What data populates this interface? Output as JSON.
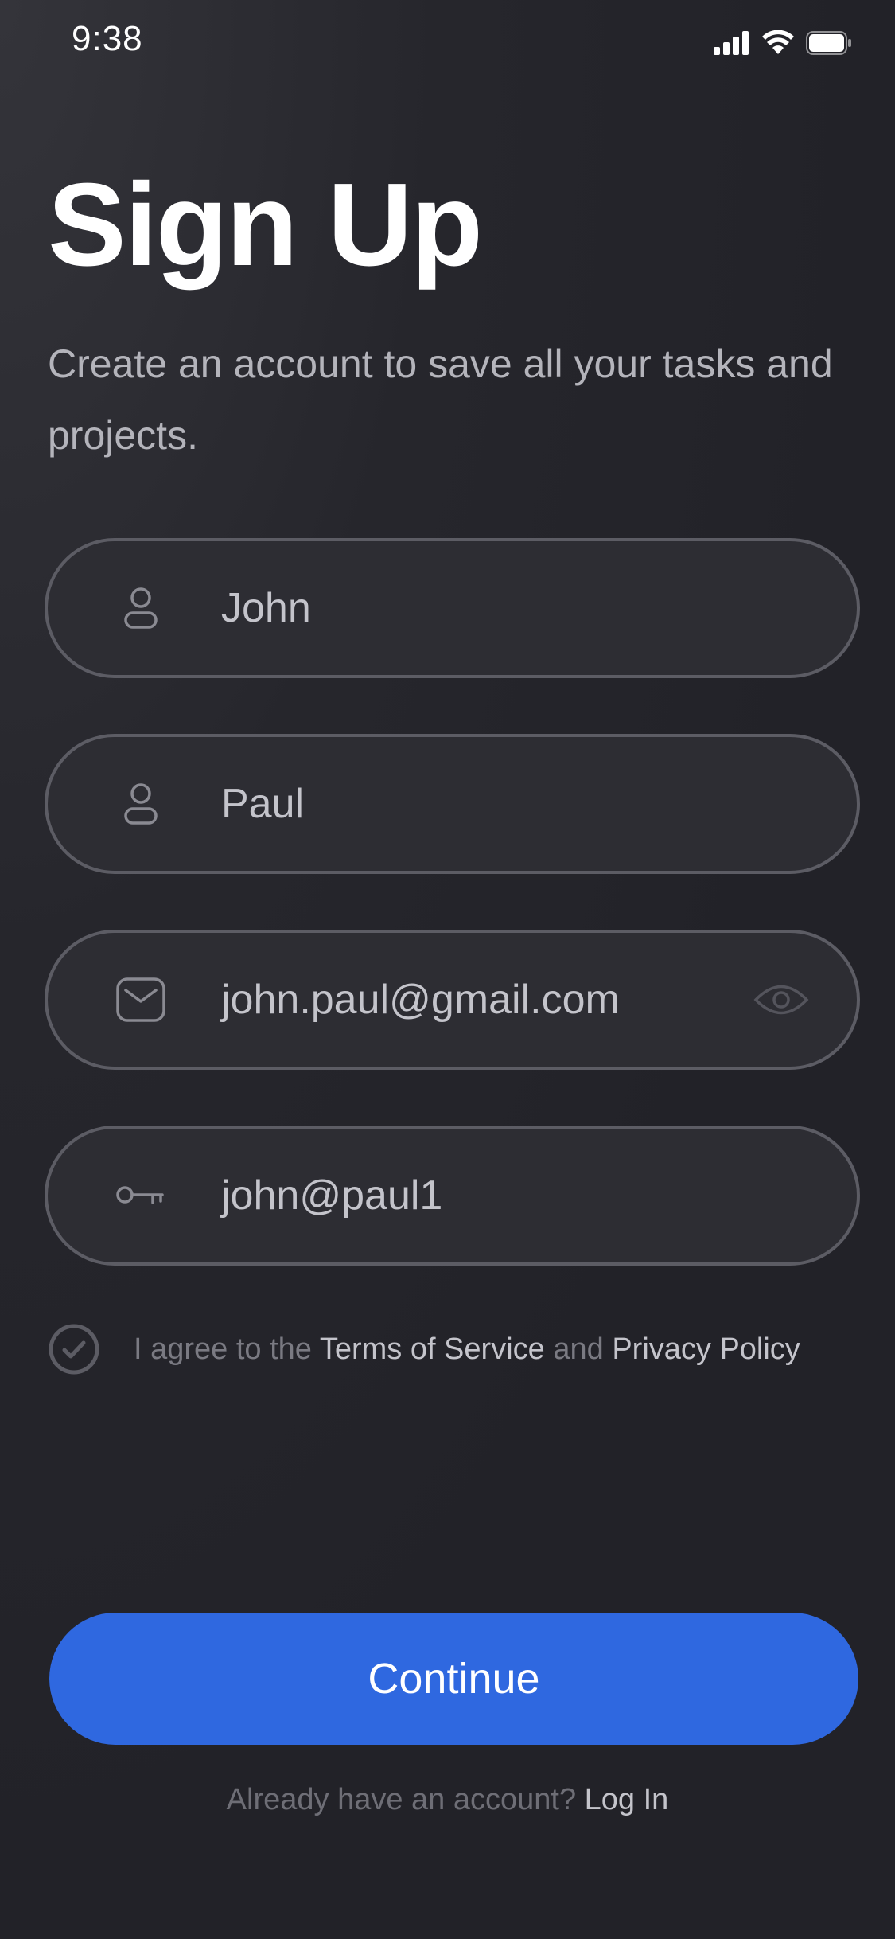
{
  "status_bar": {
    "time": "9:38",
    "icons": [
      "cellular-signal-icon",
      "wifi-icon",
      "battery-icon"
    ]
  },
  "header": {
    "title": "Sign Up",
    "subtitle": "Create an account to save all your tasks and projects."
  },
  "form": {
    "first_name": {
      "value": "John",
      "icon": "person-icon"
    },
    "last_name": {
      "value": "Paul",
      "icon": "person-icon"
    },
    "email": {
      "value": "john.paul@gmail.com",
      "icon": "mail-icon",
      "trailing_icon": "eye-icon"
    },
    "password": {
      "value": "john@paul1",
      "icon": "key-icon"
    }
  },
  "agreement": {
    "checked": true,
    "prefix": "I agree to the ",
    "terms": "Terms of Service",
    "conjunction": " and ",
    "privacy": "Privacy Policy"
  },
  "actions": {
    "continue_label": "Continue"
  },
  "footer": {
    "prompt": "Already have an account? ",
    "login_label": "Log In"
  },
  "colors": {
    "background": "#222228",
    "field_border": "#5c5c64",
    "field_fill": "#2d2d33",
    "accent": "#2f68e0",
    "muted_text": "#7a7a82"
  }
}
